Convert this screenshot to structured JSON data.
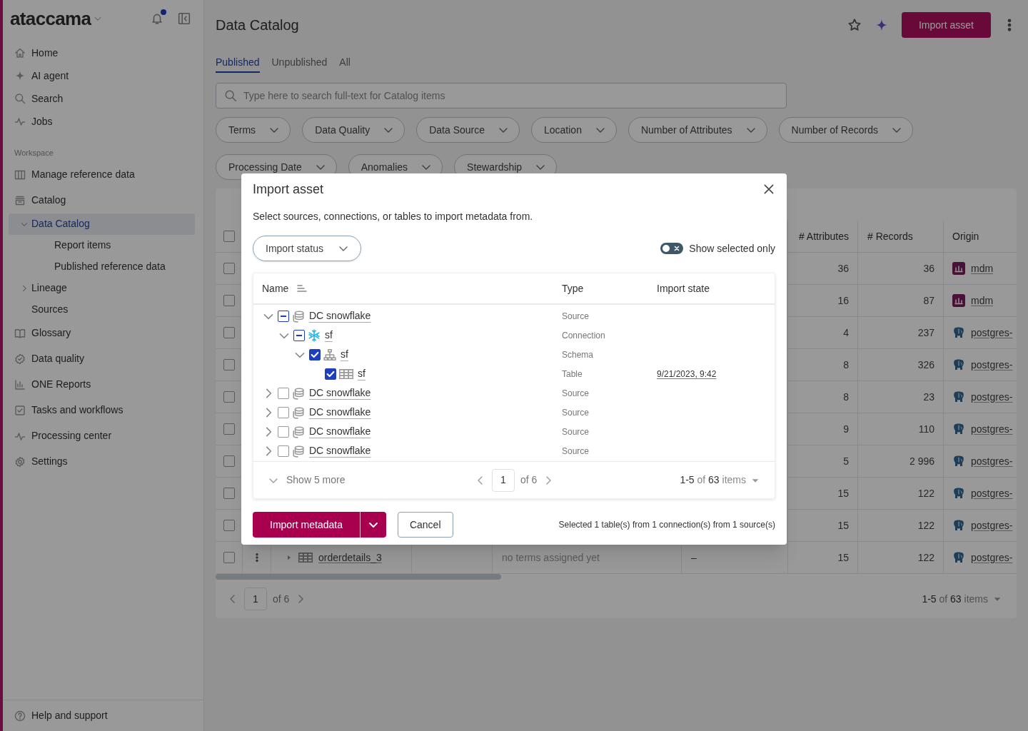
{
  "sidebar": {
    "logo": "ataccama",
    "notification_dot": true,
    "items": [
      {
        "label": "Home",
        "selected": false
      },
      {
        "label": "AI agent",
        "selected": false
      },
      {
        "label": "Search",
        "selected": false
      },
      {
        "label": "Jobs",
        "selected": false
      }
    ],
    "section": "Workspace",
    "workspace_items": [
      {
        "label": "Manage reference data",
        "selected": false
      },
      {
        "label": "Catalog",
        "selected": false,
        "children": [
          {
            "label": "Data Catalog",
            "selected": true,
            "expanded": true,
            "children": [
              {
                "label": "Report items",
                "selected": false
              },
              {
                "label": "Published reference data",
                "selected": false
              }
            ]
          },
          {
            "label": "Lineage",
            "selected": false,
            "expanded": false
          },
          {
            "label": "Sources",
            "selected": false
          }
        ]
      },
      {
        "label": "Glossary",
        "selected": false
      },
      {
        "label": "Data quality",
        "selected": false
      },
      {
        "label": "ONE Reports",
        "selected": false
      },
      {
        "label": "Tasks and workflows",
        "selected": false
      },
      {
        "label": "Processing center",
        "selected": false
      },
      {
        "label": "Settings",
        "selected": false
      }
    ],
    "help": "Help and support"
  },
  "page": {
    "title": "Data Catalog",
    "primary_button": "Import asset",
    "tabs": [
      {
        "label": "Published",
        "selected": true
      },
      {
        "label": "Unpublished",
        "selected": false
      },
      {
        "label": "All",
        "selected": false
      }
    ],
    "search": {
      "placeholder": "Type here to search full-text for Catalog items"
    },
    "filters": [
      "Terms",
      "Data Quality",
      "Data Source",
      "Location",
      "Number of Attributes",
      "Number of Records",
      "Processing Date",
      "Anomalies",
      "Stewardship"
    ]
  },
  "table": {
    "select_all_checked": false,
    "columns": [
      "# Attributes",
      "# Records",
      "Origin"
    ],
    "rows": [
      {
        "checked": false,
        "attributes": "36",
        "records": "36",
        "origin": {
          "kind": "mdm",
          "label": "mdm"
        }
      },
      {
        "checked": false,
        "attributes": "16",
        "records": "87",
        "origin": {
          "kind": "mdm",
          "label": "mdm"
        }
      },
      {
        "checked": false,
        "attributes": "4",
        "records": "237",
        "origin": {
          "kind": "postgres",
          "label": "postgres-"
        }
      },
      {
        "checked": false,
        "attributes": "8",
        "records": "326",
        "origin": {
          "kind": "postgres",
          "label": "postgres-"
        }
      },
      {
        "checked": false,
        "attributes": "8",
        "records": "23",
        "origin": {
          "kind": "postgres",
          "label": "postgres-"
        }
      },
      {
        "checked": false,
        "attributes": "9",
        "records": "110",
        "origin": {
          "kind": "postgres",
          "label": "postgres-"
        }
      },
      {
        "checked": false,
        "attributes": "5",
        "records": "2 996",
        "origin": {
          "kind": "postgres",
          "label": "postgres-"
        }
      },
      {
        "checked": false,
        "attributes": "15",
        "records": "122",
        "origin": {
          "kind": "postgres",
          "label": "postgres-"
        }
      },
      {
        "checked": false,
        "attributes": "15",
        "records": "122",
        "origin": {
          "kind": "postgres",
          "label": "postgres-"
        }
      },
      {
        "checked": false,
        "name": "orderdetails_3",
        "terms": "no terms assigned yet",
        "column_6": "–",
        "attributes": "15",
        "records": "122",
        "origin": {
          "kind": "postgres",
          "label": "postgres-"
        }
      }
    ],
    "pagination": {
      "page": "1",
      "of": "of 6",
      "summary": "**1-5** of **63** items"
    }
  },
  "dialog": {
    "title": "Import asset",
    "description": "Select sources, connections, or tables to import metadata from.",
    "filter": "Import status",
    "toggle": {
      "label": "Show selected only",
      "on": false
    },
    "columns": [
      "Name",
      "Type",
      "Import state"
    ],
    "tree": [
      {
        "name": "DC snowflake",
        "kind": "source",
        "type": "Source",
        "checked": false,
        "partial": true,
        "expanded": true,
        "children": [
          {
            "name": "sf",
            "kind": "connection",
            "type": "Connection",
            "checked": false,
            "partial": true,
            "expanded": true,
            "children": [
              {
                "name": "sf",
                "kind": "schema",
                "type": "Schema",
                "checked": true,
                "expanded": true,
                "children": [
                  {
                    "name": "sf",
                    "kind": "table",
                    "type": "Table",
                    "checked": true,
                    "import_state": "9/21/2023, 9:42"
                  }
                ]
              }
            ]
          }
        ]
      },
      {
        "name": "DC snowflake",
        "kind": "source",
        "type": "Source",
        "checked": false,
        "partial": false,
        "expanded": false
      },
      {
        "name": "DC snowflake",
        "kind": "source",
        "type": "Source",
        "checked": false,
        "partial": false,
        "expanded": false
      },
      {
        "name": "DC snowflake",
        "kind": "source",
        "type": "Source",
        "checked": false,
        "partial": false,
        "expanded": false
      },
      {
        "name": "DC snowflake",
        "kind": "source",
        "type": "Source",
        "checked": false,
        "partial": false,
        "expanded": false
      }
    ],
    "show_more": "Show 5 more",
    "pagination": {
      "page": "1",
      "of": "of 6",
      "summary": "**1-5** of **63** items"
    },
    "primary_button": "Import metadata",
    "cancel_button": "Cancel",
    "summary": "Selected 1 table(s) from 1 connection(s) from 1 source(s)"
  }
}
